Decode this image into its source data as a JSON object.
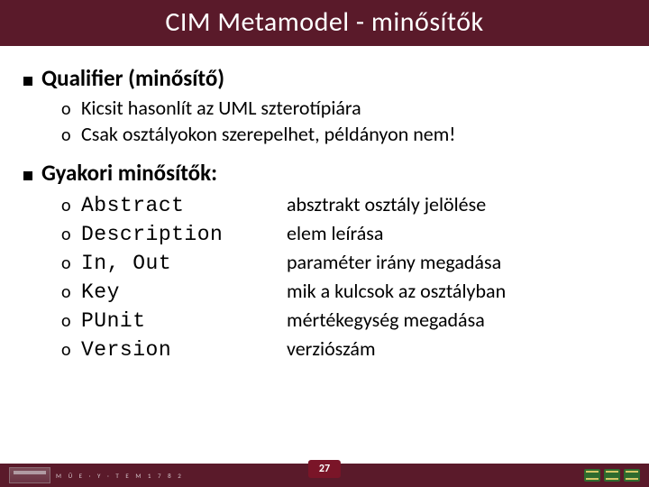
{
  "title": "CIM Metamodel - minősítők",
  "section1": {
    "heading": "Qualifier (minősítő)",
    "items": [
      "Kicsit hasonlít az UML szterotípiára",
      "Csak osztályokon szerepelhet, példányon nem!"
    ]
  },
  "section2": {
    "heading": "Gyakori minősítők:",
    "qualifiers": [
      {
        "name": "Abstract",
        "desc": "absztrakt osztály jelölése"
      },
      {
        "name": "Description",
        "desc": "elem leírása"
      },
      {
        "name": "In, Out",
        "desc": "paraméter irány megadása"
      },
      {
        "name": "Key",
        "desc": "mik a kulcsok az osztályban"
      },
      {
        "name": "PUnit",
        "desc": "mértékegység megadása"
      },
      {
        "name": "Version",
        "desc": "verziószám"
      }
    ]
  },
  "footer": {
    "org": "M Ű E · Y · T E M   1 7 8 2",
    "page": "27"
  }
}
